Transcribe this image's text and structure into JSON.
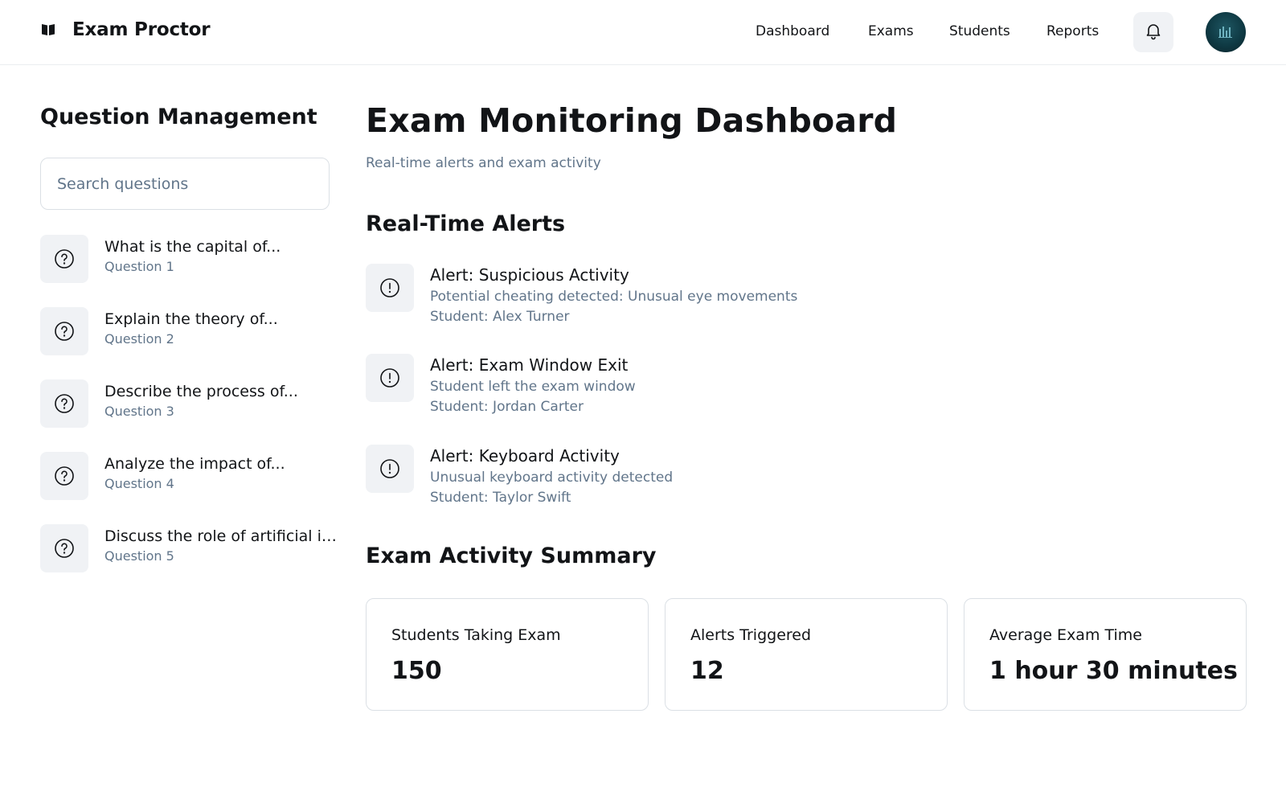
{
  "app": {
    "title": "Exam Proctor",
    "brand_icon": "book-icon"
  },
  "nav": {
    "items": [
      {
        "label": "Dashboard"
      },
      {
        "label": "Exams"
      },
      {
        "label": "Students"
      },
      {
        "label": "Reports"
      }
    ],
    "notification_icon": "bell-icon",
    "avatar_icon": "user-avatar"
  },
  "sidebar": {
    "title": "Question Management",
    "search": {
      "placeholder": "Search questions",
      "value": ""
    },
    "questions": [
      {
        "title": "What is the capital of...",
        "subtitle": "Question 1",
        "icon": "question-circle-icon"
      },
      {
        "title": "Explain the theory of...",
        "subtitle": "Question 2",
        "icon": "question-circle-icon"
      },
      {
        "title": "Describe the process of...",
        "subtitle": "Question 3",
        "icon": "question-circle-icon"
      },
      {
        "title": "Analyze the impact of...",
        "subtitle": "Question 4",
        "icon": "question-circle-icon"
      },
      {
        "title": "Discuss the role of artificial intelligence...",
        "subtitle": "Question 5",
        "icon": "question-circle-icon"
      }
    ]
  },
  "main": {
    "title": "Exam Monitoring Dashboard",
    "subtitle": "Real-time alerts and exam activity",
    "alerts_section": {
      "title": "Real-Time Alerts",
      "alerts": [
        {
          "title": "Alert: Suspicious Activity",
          "description": "Potential cheating detected: Unusual eye movements",
          "student": "Student: Alex Turner",
          "icon": "alert-circle-icon"
        },
        {
          "title": "Alert: Exam Window Exit",
          "description": "Student left the exam window",
          "student": "Student: Jordan Carter",
          "icon": "alert-circle-icon"
        },
        {
          "title": "Alert: Keyboard Activity",
          "description": "Unusual keyboard activity detected",
          "student": "Student: Taylor Swift",
          "icon": "alert-circle-icon"
        }
      ]
    },
    "summary_section": {
      "title": "Exam Activity Summary",
      "stats": [
        {
          "label": "Students Taking Exam",
          "value": "150"
        },
        {
          "label": "Alerts Triggered",
          "value": "12"
        },
        {
          "label": "Average Exam Time",
          "value": "1 hour 30 minutes"
        }
      ]
    }
  },
  "colors": {
    "text_primary": "#121417",
    "text_secondary": "#61758a",
    "icon_bg": "#f0f2f5",
    "border": "#dbe0e5"
  }
}
